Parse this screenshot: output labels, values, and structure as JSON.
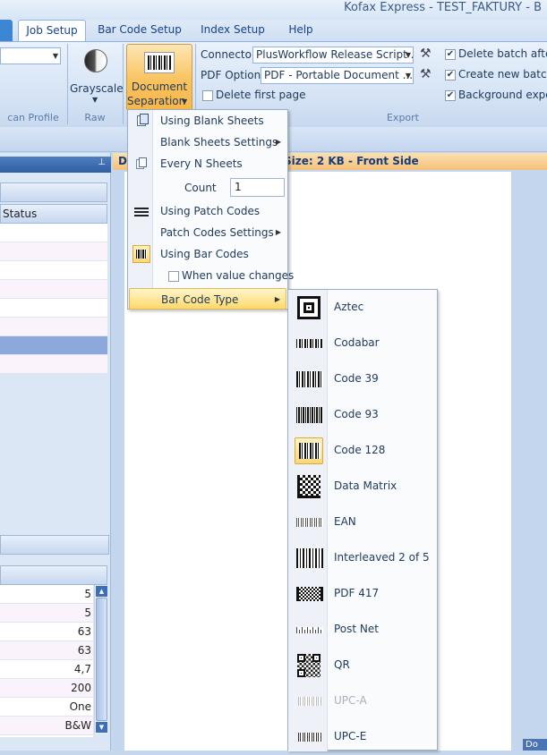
{
  "app": {
    "title": "Kofax Express - TEST_FAKTURY - B"
  },
  "tabs": [
    {
      "label": "Job Setup",
      "active": true
    },
    {
      "label": "Bar Code Setup"
    },
    {
      "label": "Index Setup"
    },
    {
      "label": "Help"
    }
  ],
  "ribbon": {
    "scan_profile_group": "can Profile",
    "raw": {
      "button_label": "Grayscale",
      "group": "Raw"
    },
    "doc_sep": {
      "line1": "Document",
      "line2": "Separation"
    },
    "export": {
      "connector_label": "Connector",
      "connector_value": "PlusWorkflow Release Script ...",
      "pdf_label": "PDF Options",
      "pdf_value": "PDF - Portable Document ...",
      "delete_first_page": "Delete first page",
      "delete_batch": "Delete batch after e",
      "create_batch": "Create new batch a",
      "background_export": "Background export",
      "group": "Export"
    }
  },
  "left_pane": {
    "status_header": "Status",
    "values": [
      "5",
      "5",
      "63",
      "63",
      "4,7",
      "200",
      "One",
      "B&W"
    ]
  },
  "document": {
    "header_prefix": "D",
    "header_text": "Size: 2 KB - Front Side"
  },
  "menu": {
    "blank_sheets": "Using Blank Sheets",
    "blank_sheets_settings": "Blank Sheets Settings",
    "every_n": "Every N Sheets",
    "count_label": "Count",
    "count_value": "1",
    "patch_codes": "Using Patch Codes",
    "patch_settings": "Patch Codes Settings",
    "bar_codes": "Using Bar Codes",
    "when_value_changes": "When value changes",
    "bar_code_type": "Bar Code Type"
  },
  "barcode_types": [
    {
      "label": "Aztec",
      "icon": "aztec-icon"
    },
    {
      "label": "Codabar",
      "icon": "codabar-icon"
    },
    {
      "label": "Code 39",
      "icon": "code39-icon"
    },
    {
      "label": "Code 93",
      "icon": "code93-icon"
    },
    {
      "label": "Code 128",
      "icon": "code128-icon",
      "selected": true
    },
    {
      "label": "Data Matrix",
      "icon": "data-matrix-icon"
    },
    {
      "label": "EAN",
      "icon": "ean-icon"
    },
    {
      "label": "Interleaved 2 of 5",
      "icon": "interleaved-icon"
    },
    {
      "label": "PDF 417",
      "icon": "pdf417-icon"
    },
    {
      "label": "Post Net",
      "icon": "postnet-icon"
    },
    {
      "label": "QR",
      "icon": "qr-icon"
    },
    {
      "label": "UPC-A",
      "icon": "upca-icon",
      "disabled": true
    },
    {
      "label": "UPC-E",
      "icon": "upce-icon"
    }
  ],
  "colors": {
    "accent_blue": "#3d86d4",
    "highlight_yellow": "#ffd96b",
    "doc_header_orange": "#f4c07a"
  }
}
